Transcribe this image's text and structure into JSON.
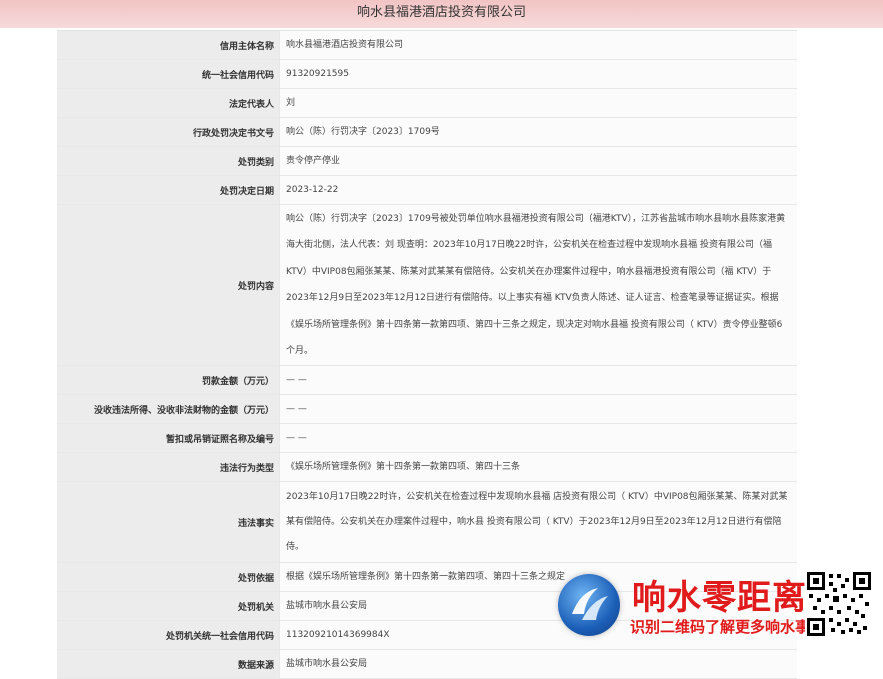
{
  "title": "响水县福港酒店投资有限公司",
  "rows": [
    {
      "label": "信用主体名称",
      "value": "响水县福港酒店投资有限公司"
    },
    {
      "label": "统一社会信用代码",
      "value": "91320921595"
    },
    {
      "label": "法定代表人",
      "value": "刘"
    },
    {
      "label": "行政处罚决定书文号",
      "value": "响公（陈）行罚决字〔2023〕1709号"
    },
    {
      "label": "处罚类别",
      "value": "责令停产停业"
    },
    {
      "label": "处罚决定日期",
      "value": "2023-12-22"
    },
    {
      "label": "处罚内容",
      "value": "响公（陈）行罚决字〔2023〕1709号被处罚单位响水县福港投资有限公司（福港KTV），江苏省盐城市响水县响水县陈家港黄海大街北侧，法人代表：刘 现查明：2023年10月17日晚22时许，公安机关在检查过程中发现响水县福 投资有限公司（福 KTV）中VIP08包厢张某某、陈某对武某某有偿陪侍。公安机关在办理案件过程中，响水县福港投资有限公司（福 KTV）于2023年12月9日至2023年12月12日进行有偿陪侍。以上事实有福 KTV负责人陈述、证人证言、检查笔录等证据证实。根据《娱乐场所管理条例》第十四条第一款第四项、第四十三条之规定，现决定对响水县福 投资有限公司（ KTV）责令停业整顿6个月。"
    },
    {
      "label": "罚款金额（万元）",
      "value": "— —"
    },
    {
      "label": "没收违法所得、没收非法财物的金额（万元）",
      "value": "— —"
    },
    {
      "label": "暂扣或吊销证照名称及编号",
      "value": "— —"
    },
    {
      "label": "违法行为类型",
      "value": "《娱乐场所管理条例》第十四条第一款第四项、第四十三条"
    },
    {
      "label": "违法事实",
      "value": "2023年10月17日晚22时许，公安机关在检查过程中发现响水县福 店投资有限公司（ KTV）中VIP08包厢张某某、陈某对武某某有偿陪侍。公安机关在办理案件过程中，响水县 投资有限公司（ KTV）于2023年12月9日至2023年12月12日进行有偿陪侍。"
    },
    {
      "label": "处罚依据",
      "value": "根据《娱乐场所管理条例》第十四条第一款第四项、第四十三条之规定"
    },
    {
      "label": "处罚机关",
      "value": "盐城市响水县公安局"
    },
    {
      "label": "处罚机关统一社会信用代码",
      "value": "11320921014369984X"
    },
    {
      "label": "数据来源",
      "value": "盐城市响水县公安局"
    }
  ],
  "watermark": {
    "title": "响水零距离",
    "subtitle": "识别二维码了解更多响水事"
  }
}
